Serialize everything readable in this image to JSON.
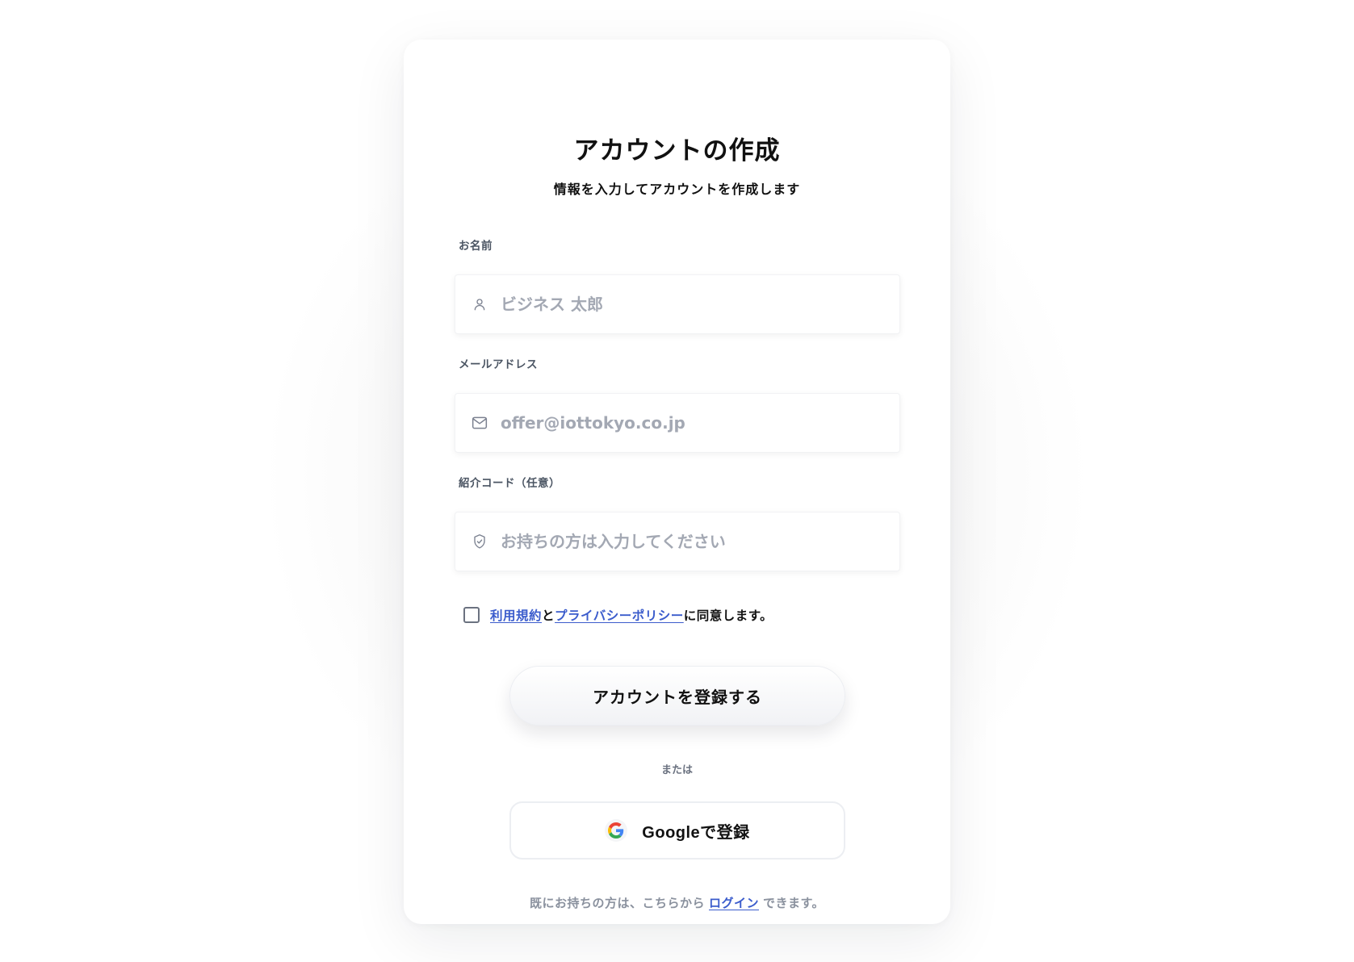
{
  "header": {
    "title": "アカウントの作成",
    "subtitle": "情報を入力してアカウントを作成します"
  },
  "fields": {
    "name": {
      "label": "お名前",
      "placeholder": "ビジネス 太郎",
      "value": "",
      "icon": "user-icon"
    },
    "email": {
      "label": "メールアドレス",
      "placeholder": "offer@iottokyo.co.jp",
      "value": "",
      "icon": "mail-icon"
    },
    "referral": {
      "label": "紹介コード（任意）",
      "placeholder": "お持ちの方は入力してください",
      "value": "",
      "icon": "shield-check-icon"
    }
  },
  "agreement": {
    "checked": false,
    "terms_link": "利用規約",
    "connector": "と",
    "privacy_link": "プライバシーポリシー",
    "suffix": "に同意します。"
  },
  "actions": {
    "register_label": "アカウントを登録する",
    "divider_label": "または",
    "google_label": "Googleで登録",
    "google_icon": "google-g-icon"
  },
  "footer": {
    "prefix": "既にお持ちの方は、こちらから",
    "login_link": "ログイン",
    "suffix": "できます。"
  },
  "colors": {
    "accent_link": "#3b5ccc",
    "text_primary": "#111111",
    "text_muted": "#8a919e",
    "placeholder": "#a3a8b3"
  }
}
